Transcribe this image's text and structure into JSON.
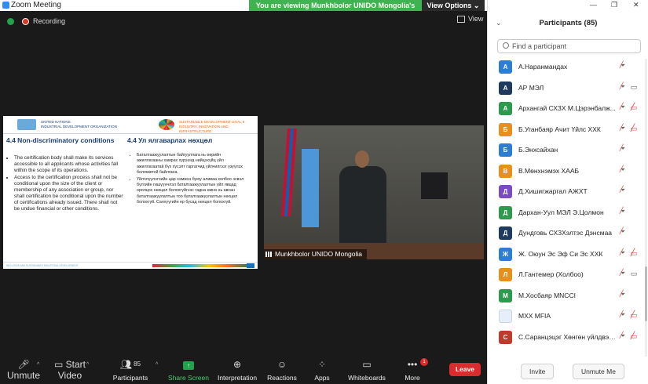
{
  "window": {
    "title": "Zoom Meeting",
    "viewing_banner": "You are viewing Munkhbolor UNIDO Mongolia's screen",
    "view_options": "View Options ⌄"
  },
  "meeting": {
    "recording_label": "Recording",
    "view_button": "View"
  },
  "slide": {
    "org_name_line1": "UNITED NATIONS",
    "org_name_line2": "INDUSTRIAL DEVELOPMENT ORGANIZATION",
    "sdg_title_line1": "SUSTAINABLE DEVELOPMENT GOAL 9",
    "sdg_title_line2": "INDUSTRY, INNOVATION AND INFRASTRUCTURE",
    "left_heading": "4.4 Non-discriminatory conditions",
    "left_bullets": [
      "The certification body shall make its services accessible to all applicants whose activities fall within the scope of its operations.",
      "Access to the certification process shall not be conditional upon the size of the client or membership of any association or group, nor shall certification be conditional upon the number of certifications already issued. There shall not be undue financial or other conditions."
    ],
    "right_heading": "4.4 Ул ялгаварлах нөхцөл",
    "right_bullets": [
      "Баталгаажуулалтын байгууллага нь өөрийн ажиллагааны хамрах хүрээнд нийцэхүйц үйл ажиллагаатай бүх хүсэлт гаргагчид үйлчилгээг үзүүлэх боломжтой байлгана.",
      "Үйлчлүүлэгчийн цар хэмжээ буюу аливаа холбоо эсвэл бүлгийн гишүүнчлэл баталгаажуулалтын үйл явцад оролцох нөхцөл болохгүйгээс гадна өмнө нь авсан баталгаажуулалтын тоо баталгаажуулалтын нөхцөл болохгүй. Санхүүгийн ер бусад нөхцөл болохгүй."
    ],
    "footer_text": "INCLUSIVE AND SUSTAINABLE INDUSTRIAL DEVELOPMENT"
  },
  "presenter": {
    "name": "Munkhbolor UNIDO Mongolia"
  },
  "toolbar": {
    "unmute": "Unmute",
    "start_video": "Start Video",
    "participants": "Participants",
    "participants_count": "85",
    "share_screen": "Share Screen",
    "interpretation": "Interpretation",
    "reactions": "Reactions",
    "apps": "Apps",
    "whiteboards": "Whiteboards",
    "more": "More",
    "more_badge": "1",
    "leave": "Leave"
  },
  "panel": {
    "title": "Participants (85)",
    "search_placeholder": "Find a participant",
    "participants": [
      {
        "initial": "А",
        "name": "А.Наранмандах",
        "color": "#2d7dd2",
        "video": "none"
      },
      {
        "initial": "А",
        "name": "АР МЭЛ",
        "color": "#1e3a5f",
        "video": "on"
      },
      {
        "initial": "А",
        "name": "Архангай СХЗХ М.Цэрэнбалж...",
        "color": "#2e9a4e",
        "video": "off"
      },
      {
        "initial": "Б",
        "name": "Б.Уганбаяр Ачит Үйлс ХХК",
        "color": "#e8901c",
        "video": "off"
      },
      {
        "initial": "Б",
        "name": "Б.Энхсайхан",
        "color": "#2d7dd2",
        "video": "none"
      },
      {
        "initial": "В",
        "name": "В.Мөнхнэмэх ХААБ",
        "color": "#e8901c",
        "video": "none"
      },
      {
        "initial": "Д",
        "name": "Д.Хишигжаргал АЖХТ",
        "color": "#7a4cc2",
        "video": "none"
      },
      {
        "initial": "Д",
        "name": "Дархан-Уул МЭЛ Э.Цолмон",
        "color": "#2e9a4e",
        "video": "none"
      },
      {
        "initial": "Д",
        "name": "Дундговь СХЗХэлтэс Дэнсмаа",
        "color": "#1e3a5f",
        "video": "none"
      },
      {
        "initial": "Ж",
        "name": "Ж. Оюун Эс Эф Си Эс ХХК",
        "color": "#2d7dd2",
        "video": "off"
      },
      {
        "initial": "Л",
        "name": "Л.Гантемер (Холбоо)",
        "color": "#e8901c",
        "video": "on"
      },
      {
        "initial": "М",
        "name": "М.Хосбаяр MNCCI",
        "color": "#2e9a4e",
        "video": "none"
      },
      {
        "initial": "",
        "name": "МХХ MFIA",
        "color": "#e8eef7",
        "video": "off"
      },
      {
        "initial": "С",
        "name": "С.Саранцэцэг Хөнгөн үйлдвэрий...",
        "color": "#c0392b",
        "video": "off"
      }
    ],
    "invite": "Invite",
    "unmute_me": "Unmute Me"
  }
}
